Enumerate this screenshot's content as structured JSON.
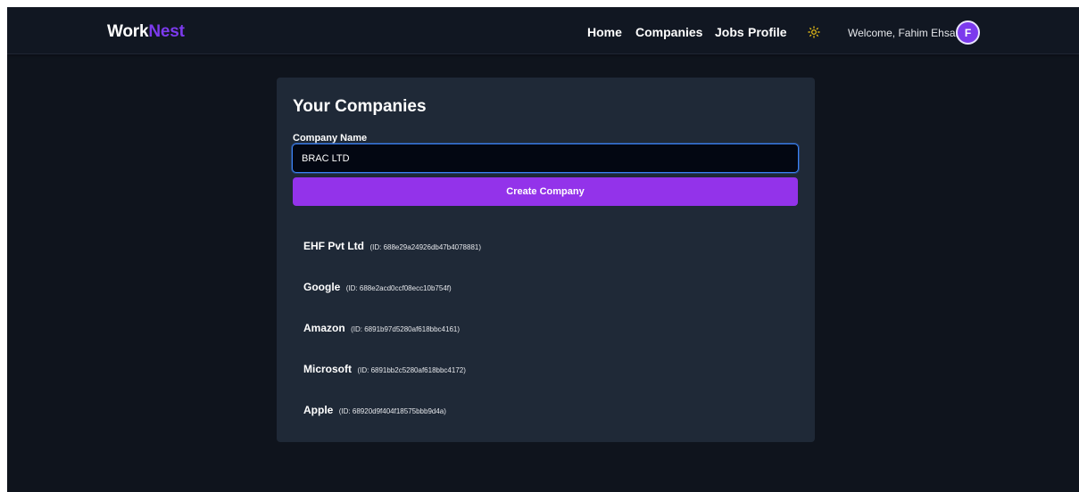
{
  "brand": {
    "part1": "Work",
    "part2": "Nest"
  },
  "nav": {
    "links": [
      "Home",
      "Companies",
      "Jobs",
      "Profile"
    ],
    "theme_icon": "sun-icon",
    "welcome_text": "Welcome, Fahim Ehsan",
    "avatar_initial": "F"
  },
  "colors": {
    "background": "#0f141d",
    "navbar": "#111722",
    "card": "#1f2937",
    "accent": "#9333ea",
    "brand_accent": "#7c3aed",
    "sun": "#facc15",
    "input_focus": "#3b82f6"
  },
  "companies_form": {
    "title": "Your Companies",
    "field_label": "Company Name",
    "input_value": "BRAC LTD",
    "submit_label": "Create Company"
  },
  "company_list": [
    {
      "name": "EHF Pvt Ltd",
      "id": "(ID: 688e29a24926db47b4078881)"
    },
    {
      "name": "Google",
      "id": "(ID: 688e2acd0ccf08ecc10b754f)"
    },
    {
      "name": "Amazon",
      "id": "(ID: 6891b97d5280af618bbc4161)"
    },
    {
      "name": "Microsoft",
      "id": "(ID: 6891bb2c5280af618bbc4172)"
    },
    {
      "name": "Apple",
      "id": "(ID: 68920d9f404f18575bbb9d4a)"
    }
  ]
}
